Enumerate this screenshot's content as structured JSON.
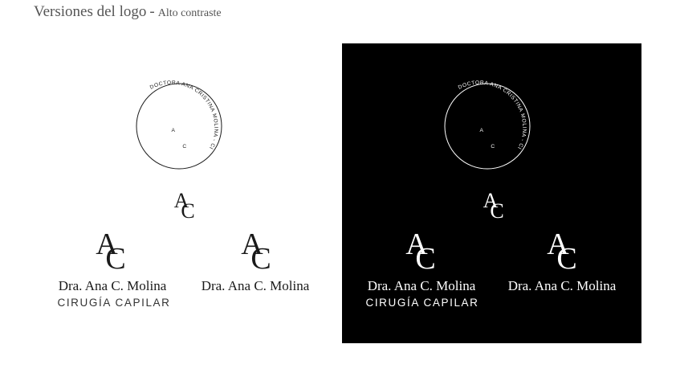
{
  "header": {
    "title": "Versiones del logo",
    "separator": "-",
    "subtitle": "Alto contraste"
  },
  "logo": {
    "monogram_a": "A",
    "monogram_c": "C",
    "seal_text": "DOCTORA ANA CRISTINA MOLINA - CIRUGÍA CAPILAR",
    "name": "Dra. Ana C. Molina",
    "tagline": "CIRUGÍA CAPILAR"
  },
  "variants": {
    "light": {
      "background": "#ffffff",
      "foreground": "#1a1a1a"
    },
    "dark": {
      "background": "#000000",
      "foreground": "#ffffff"
    }
  }
}
